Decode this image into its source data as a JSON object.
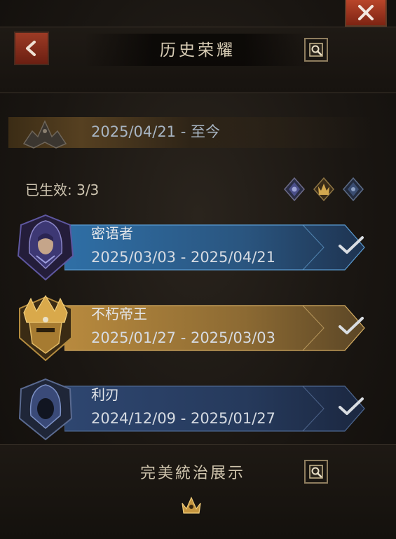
{
  "header": {
    "title": "历史荣耀"
  },
  "current": {
    "date_range": "2025/04/21 - 至今"
  },
  "status": {
    "active_label": "已生效: 3/3"
  },
  "entries": [
    {
      "name": "密语者",
      "range": "2025/03/03 - 2025/04/21",
      "theme": "blue",
      "icon": "hooded-mage-portrait-icon"
    },
    {
      "name": "不朽帝王",
      "range": "2025/01/27 - 2025/03/03",
      "theme": "gold",
      "icon": "crowned-king-portrait-icon"
    },
    {
      "name": "利刃",
      "range": "2024/12/09 - 2025/01/27",
      "theme": "steel",
      "icon": "hooded-figure-portrait-icon"
    }
  ],
  "footer": {
    "title": "完美統治展示"
  },
  "colors": {
    "blue_bar": "#2f5f8c",
    "gold_bar": "#a57a35",
    "steel_bar": "#2a3e5e",
    "close_red": "#b8452a"
  }
}
